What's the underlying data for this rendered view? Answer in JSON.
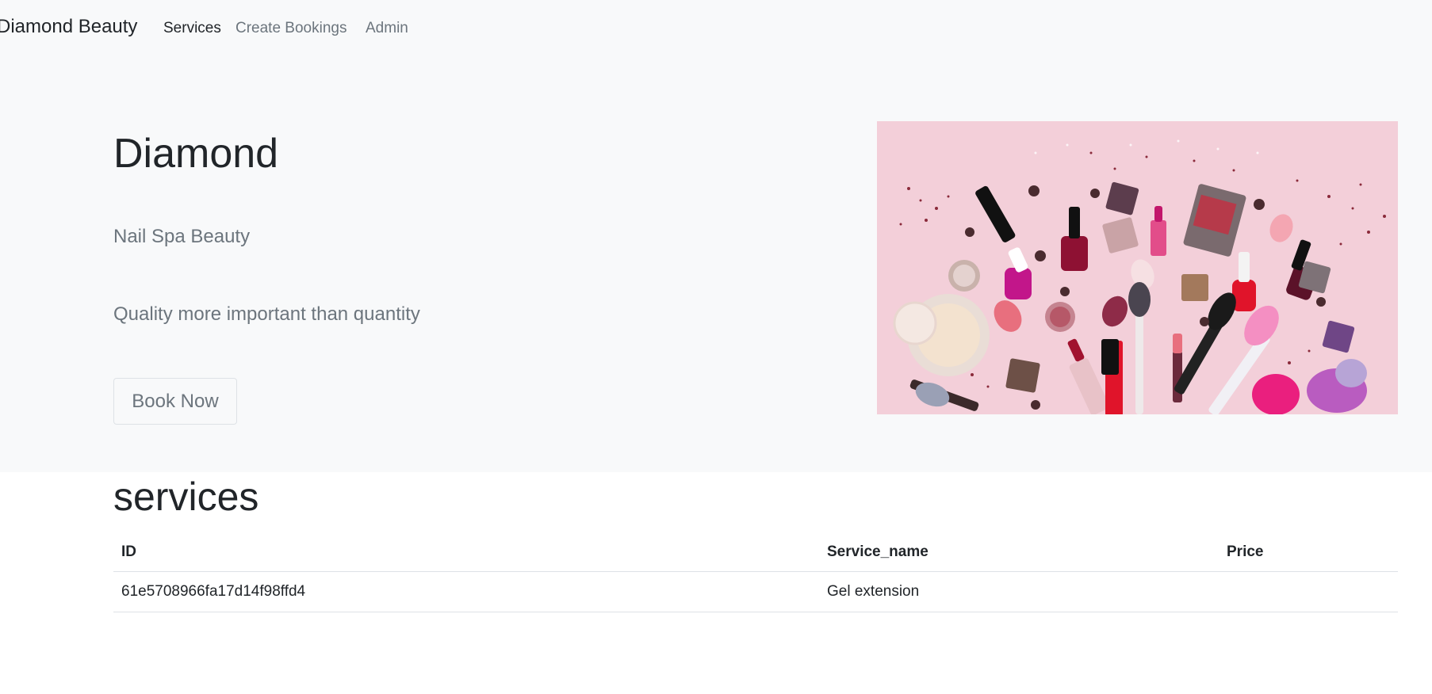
{
  "navbar": {
    "brand": "Diamond Beauty",
    "links": [
      {
        "label": "Services",
        "active": true
      },
      {
        "label": "Create Bookings",
        "active": false
      },
      {
        "label": "Admin",
        "active": false
      }
    ]
  },
  "hero": {
    "title": "Diamond",
    "subtitle": "Nail Spa Beauty",
    "tagline": "Quality more important than quantity",
    "button_label": "Book Now",
    "image_icon": "makeup-flatlay-image"
  },
  "services": {
    "heading": "services",
    "columns": [
      "ID",
      "Service_name",
      "Price"
    ],
    "rows": [
      {
        "id": "61e5708966fa17d14f98ffd4",
        "service_name": "Gel extension",
        "price": ""
      }
    ]
  },
  "colors": {
    "light_bg": "#f8f9fa",
    "text": "#212529",
    "muted": "#6c757d",
    "image_bg": "#f3cfd9",
    "border": "#dee2e6"
  }
}
